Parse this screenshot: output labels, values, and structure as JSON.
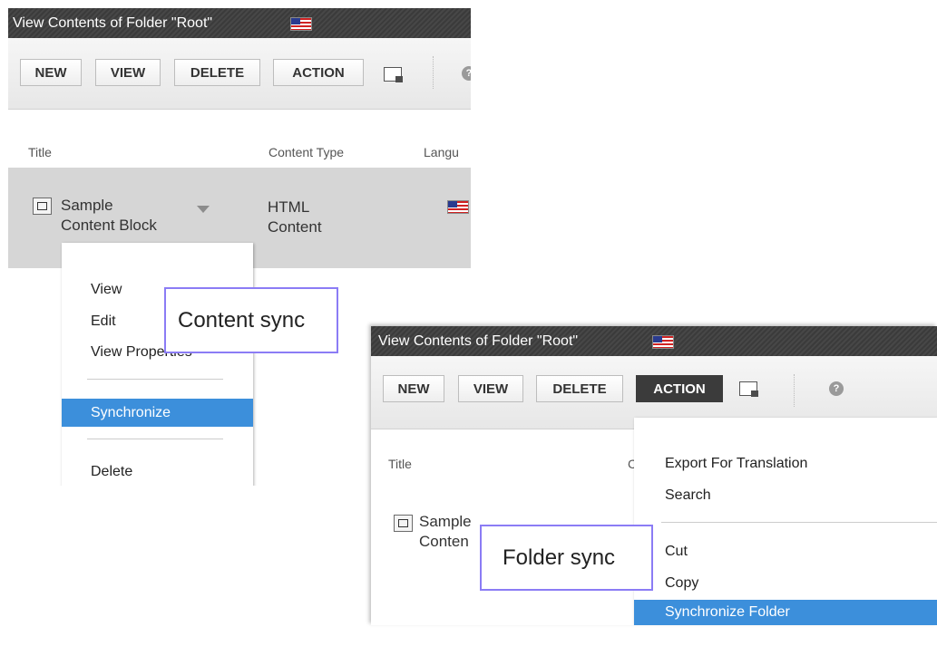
{
  "content_panel": {
    "title": "View Contents of Folder \"Root\"",
    "toolbar": {
      "new_label": "NEW",
      "view_label": "VIEW",
      "delete_label": "DELETE",
      "action_label": "ACTION"
    },
    "columns": {
      "title": "Title",
      "content_type": "Content Type",
      "language": "Langu"
    },
    "row": {
      "title_line1": "Sample",
      "title_line2": "Content Block",
      "type_line1": "HTML",
      "type_line2": "Content"
    },
    "menu": {
      "view": "View",
      "edit": "Edit",
      "view_properties": "View Properties",
      "synchronize": "Synchronize",
      "delete": "Delete"
    },
    "callout": "Content sync"
  },
  "folder_panel": {
    "title": "View Contents of Folder \"Root\"",
    "toolbar": {
      "new_label": "NEW",
      "view_label": "VIEW",
      "delete_label": "DELETE",
      "action_label": "ACTION"
    },
    "columns": {
      "title": "Title",
      "content_type": "C"
    },
    "row": {
      "title_line1": "Sample",
      "title_line2": "Conten"
    },
    "menu": {
      "export_for_translation": "Export For Translation",
      "search": "Search",
      "cut": "Cut",
      "copy": "Copy",
      "synchronize_folder": "Synchronize Folder"
    },
    "callout": "Folder sync"
  },
  "icons": {
    "flag": "us-flag-icon",
    "upload": "upload-icon",
    "help": "help-icon",
    "content": "content-item-icon"
  },
  "colors": {
    "titlebar": "#3b3b3b",
    "highlight": "#3c8fdb",
    "callout_border": "#8b7cf5",
    "row_bg": "#d6d6d6"
  }
}
